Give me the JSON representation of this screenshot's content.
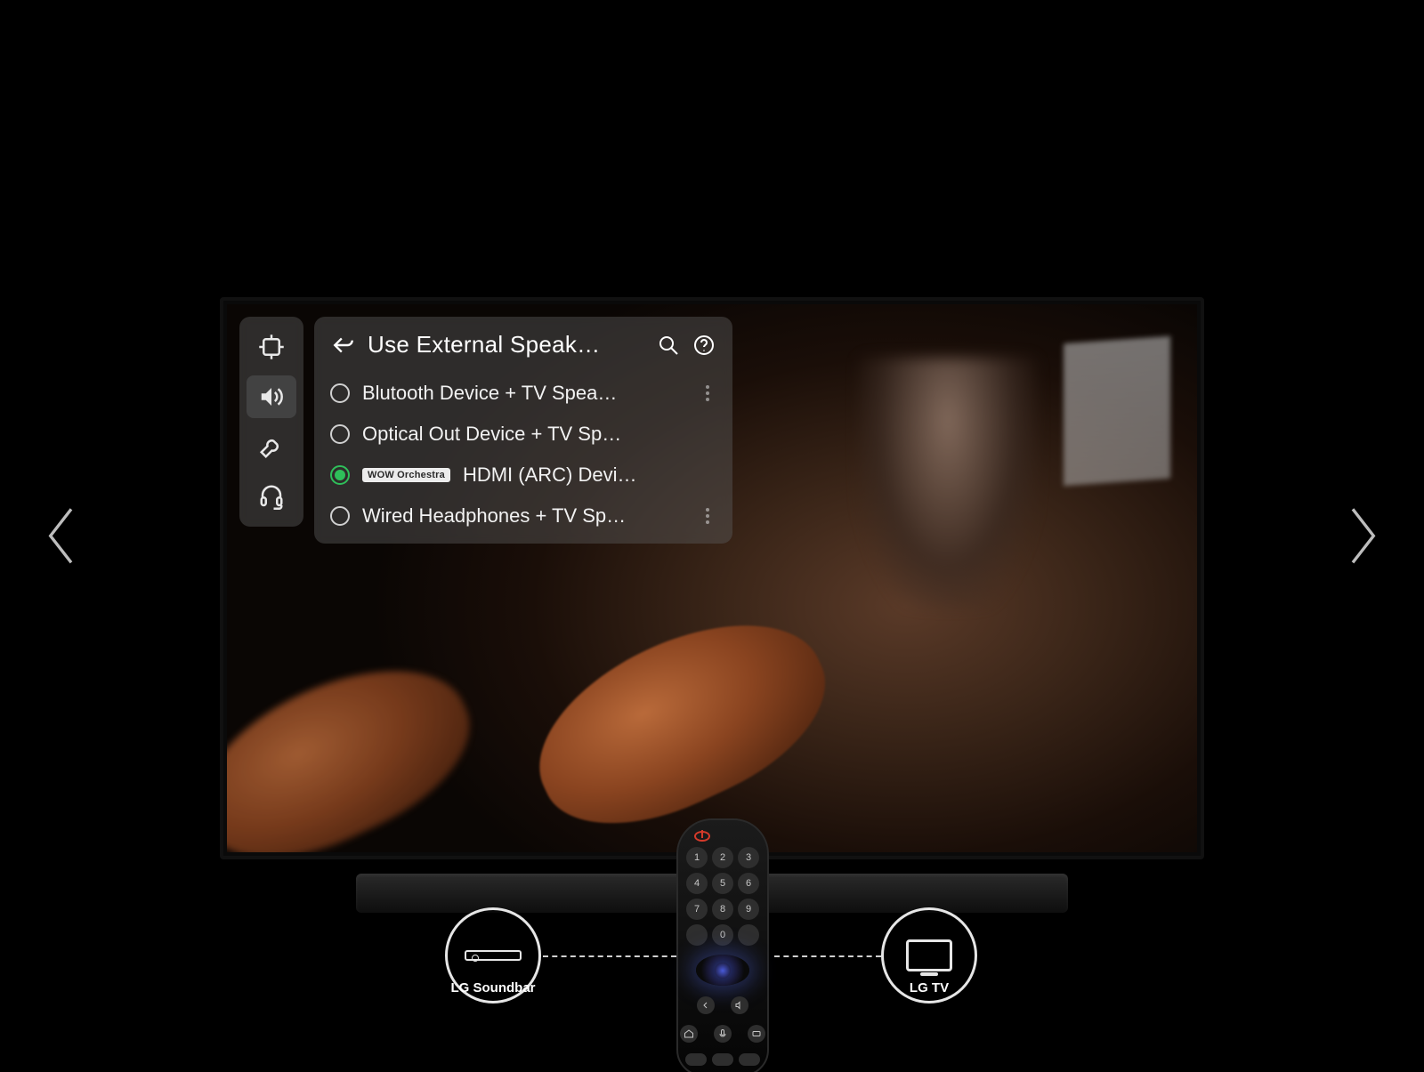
{
  "carousel": {
    "has_prev": true,
    "has_next": true
  },
  "settings": {
    "panel_title": "Use External Speak…",
    "sidebar": {
      "items": [
        {
          "id": "picture",
          "icon": "brightness-icon",
          "active": false
        },
        {
          "id": "sound",
          "icon": "sound-icon",
          "active": true
        },
        {
          "id": "general",
          "icon": "wrench-icon",
          "active": false
        },
        {
          "id": "support",
          "icon": "headset-icon",
          "active": false
        }
      ]
    },
    "options": [
      {
        "label": "Blutooth Device + TV Spea…",
        "selected": false,
        "badge": null,
        "has_more": true
      },
      {
        "label": "Optical Out Device + TV Sp…",
        "selected": false,
        "badge": null,
        "has_more": false
      },
      {
        "label": "HDMI (ARC) Devi…",
        "selected": true,
        "badge": "WOW Orchestra",
        "has_more": false
      },
      {
        "label": "Wired Headphones + TV Sp…",
        "selected": false,
        "badge": null,
        "has_more": true
      }
    ]
  },
  "devices": {
    "soundbar_label": "LG Soundbar",
    "tv_label": "LG TV"
  },
  "remote": {
    "keys": [
      "1",
      "2",
      "3",
      "4",
      "5",
      "6",
      "7",
      "8",
      "9",
      "",
      "0",
      ""
    ]
  }
}
